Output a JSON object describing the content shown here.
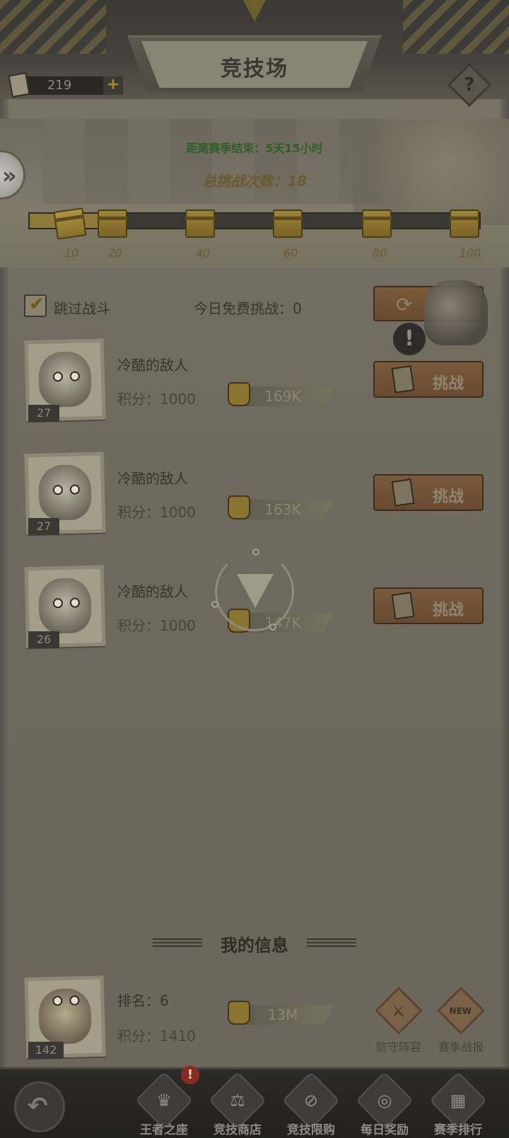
{
  "header": {
    "title": "竞技场",
    "currency_amount": "219",
    "currency_plus": "+",
    "help_label": "?"
  },
  "banner": {
    "season_timer": "距离赛季结束：5天15小时",
    "total_challenges": "总挑战次数：18",
    "side_arrow": "»",
    "progress": 0.18,
    "milestones": [
      "10",
      "20",
      "40",
      "60",
      "80",
      "100"
    ]
  },
  "controls": {
    "skip_checkmark": "✔",
    "skip_label": "跳过战斗",
    "free_challenges": "今日免费挑战：0",
    "refresh_icon": "⟳",
    "alert_icon": "!"
  },
  "opponents": [
    {
      "name": "冷酷的敌人",
      "score": "积分：1000",
      "power": "169K",
      "level": "27",
      "button": "挑战"
    },
    {
      "name": "冷酷的敌人",
      "score": "积分：1000",
      "power": "163K",
      "level": "27",
      "button": "挑战"
    },
    {
      "name": "冷酷的敌人",
      "score": "积分：1000",
      "power": "147K",
      "level": "26",
      "button": "挑战"
    }
  ],
  "my_info": {
    "title": "我的信息",
    "rank": "排名：6",
    "score": "积分：1410",
    "power": "13M",
    "level": "142",
    "defense_icon": "⚔",
    "defense_label": "防守阵容",
    "season_report_icon": "NEW",
    "season_report_label": "赛季战报"
  },
  "bottom_nav": {
    "back_icon": "↶",
    "alert_badge": "!",
    "items": [
      {
        "label": "王者之座",
        "icon": "♛"
      },
      {
        "label": "竞技商店",
        "icon": "⚖"
      },
      {
        "label": "竞技限购",
        "icon": "⊘"
      },
      {
        "label": "每日奖励",
        "icon": "◎"
      },
      {
        "label": "赛季排行",
        "icon": "▦"
      }
    ]
  },
  "colors": {
    "accent_gold": "#8f7a3a",
    "button_brown": "#7a5a3c",
    "alert_red": "#8a2a22"
  }
}
